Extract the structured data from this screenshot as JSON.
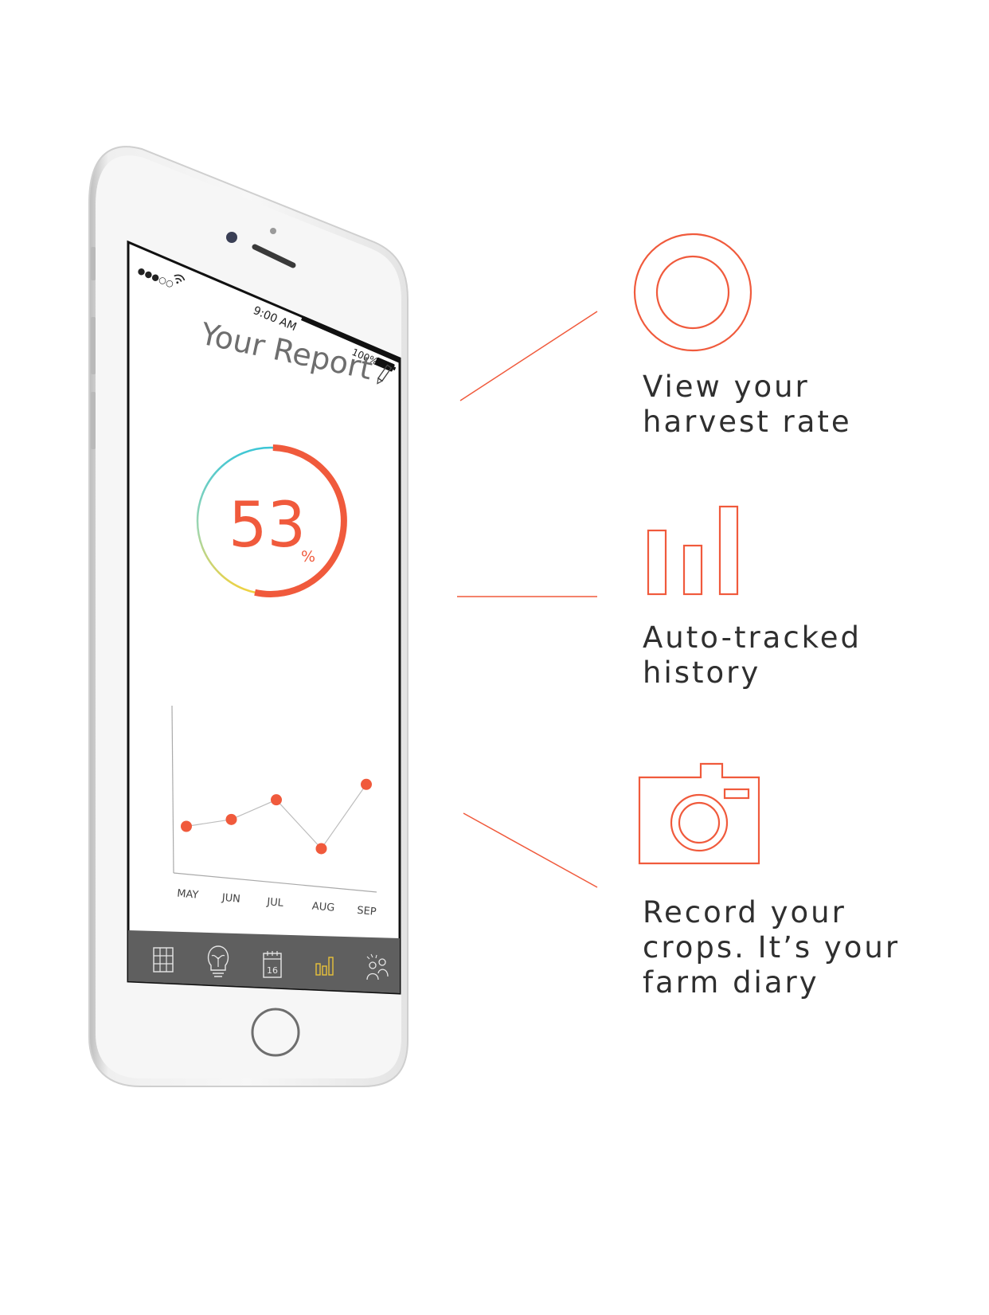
{
  "colors": {
    "accent": "#f05a3c",
    "ring_teal": "#3cc6d6",
    "ring_yellow": "#f2d23c",
    "tabbar": "#5f5f5f",
    "tab_active": "#e8c23a",
    "text": "#2f2f2f"
  },
  "phone": {
    "status_bar": {
      "signal": "●●●○○",
      "time": "9:00 AM",
      "battery": "100%"
    },
    "screen_title": "Your Report",
    "edit_icon": "pencil-icon",
    "harvest_rate": {
      "value": "53",
      "unit": "%",
      "fraction": 0.53
    },
    "chart_data": {
      "type": "line",
      "categories": [
        "MAY",
        "JUN",
        "JUL",
        "AUG",
        "SEP"
      ],
      "values": [
        30,
        37,
        52,
        24,
        67
      ],
      "ylim": [
        0,
        100
      ],
      "grid": false
    },
    "tabbar": {
      "tabs": [
        {
          "icon": "grid-icon"
        },
        {
          "icon": "lightbulb-icon"
        },
        {
          "icon": "calendar-icon",
          "day": "16"
        },
        {
          "icon": "bar-chart-icon",
          "active": true
        },
        {
          "icon": "people-icon"
        }
      ]
    }
  },
  "features": [
    {
      "icon": "ring-icon",
      "text": "View your\nharvest rate"
    },
    {
      "icon": "bar-chart-icon",
      "text": "Auto-tracked\nhistory"
    },
    {
      "icon": "camera-icon",
      "text": "Record your\ncrops. It’s your\nfarm diary"
    }
  ]
}
